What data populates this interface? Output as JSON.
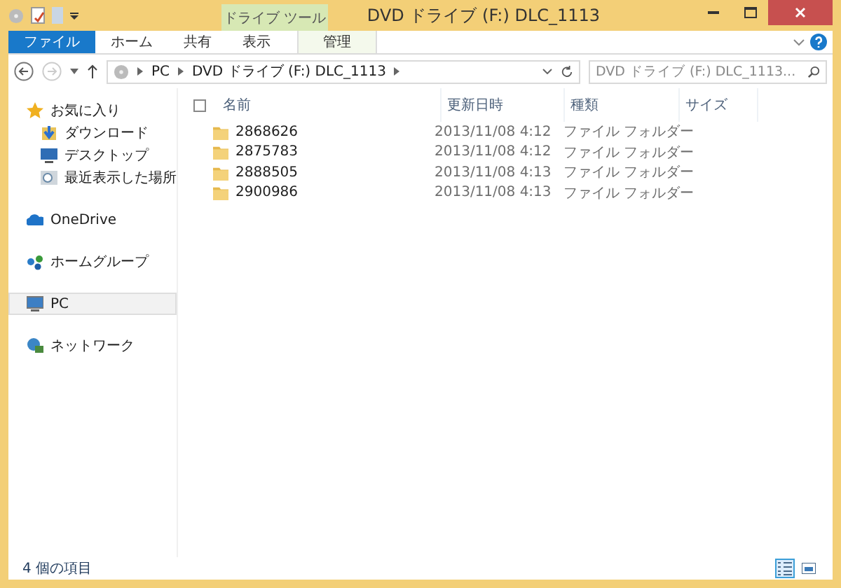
{
  "window": {
    "title": "DVD ドライブ (F:) DLC_1113",
    "contextual_group": "ドライブ ツール"
  },
  "ribbon_tabs": [
    {
      "label": "ファイル",
      "kind": "file"
    },
    {
      "label": "ホーム",
      "kind": "normal"
    },
    {
      "label": "共有",
      "kind": "normal"
    },
    {
      "label": "表示",
      "kind": "normal"
    },
    {
      "label": "管理",
      "kind": "contextual"
    }
  ],
  "address": {
    "path": [
      "PC",
      "DVD ドライブ (F:) DLC_1113"
    ]
  },
  "search": {
    "placeholder": "DVD ドライブ (F:) DLC_1113..."
  },
  "nav_pane": [
    {
      "label": "お気に入り",
      "kind": "favorites",
      "selected": false,
      "children": [
        {
          "label": "ダウンロード",
          "kind": "download",
          "selected": false
        },
        {
          "label": "デスクトップ",
          "kind": "desktop",
          "selected": false
        },
        {
          "label": "最近表示した場所",
          "kind": "recent",
          "selected": false
        }
      ]
    },
    {
      "label": "OneDrive",
      "kind": "onedrive",
      "selected": false
    },
    {
      "label": "ホームグループ",
      "kind": "homegroup",
      "selected": false
    },
    {
      "label": "PC",
      "kind": "pc",
      "selected": true
    },
    {
      "label": "ネットワーク",
      "kind": "network",
      "selected": false
    }
  ],
  "table": {
    "select_all": {
      "checked": false
    },
    "columns": [
      "名前",
      "更新日時",
      "種類",
      "サイズ"
    ],
    "rows": [
      {
        "name": "2868626",
        "modified": "2013/11/08 4:12",
        "type": "ファイル フォルダー"
      },
      {
        "name": "2875783",
        "modified": "2013/11/08 4:12",
        "type": "ファイル フォルダー"
      },
      {
        "name": "2888505",
        "modified": "2013/11/08 4:13",
        "type": "ファイル フォルダー"
      },
      {
        "name": "2900986",
        "modified": "2013/11/08 4:13",
        "type": "ファイル フォルダー"
      }
    ]
  },
  "status_bar": {
    "text": "4 個の項目",
    "views": [
      {
        "kind": "details",
        "selected": true
      },
      {
        "kind": "large_icons",
        "selected": false
      }
    ]
  }
}
